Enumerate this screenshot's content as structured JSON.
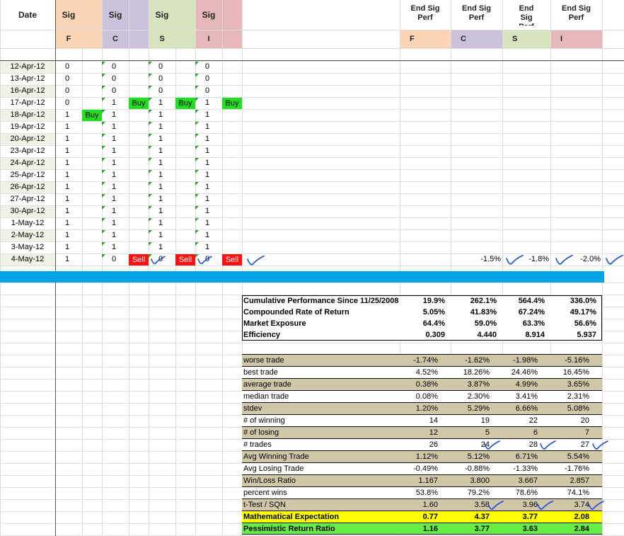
{
  "headers": {
    "date": "Date",
    "sig": [
      "Sig",
      "Sig",
      "Sig",
      "Sig"
    ],
    "sig_funds": [
      "F",
      "C",
      "S",
      "I"
    ],
    "perf": [
      "End Sig Perf",
      "End Sig Perf",
      "End Sig Perf",
      "End Sig Perf"
    ],
    "perf_funds": [
      "F",
      "C",
      "S",
      "I"
    ]
  },
  "colors": {
    "F": "#fbd5b5",
    "C": "#ccc1da",
    "S": "#d7e4bd",
    "I": "#e6b9b8",
    "buy": "#22dd22",
    "sell": "#ff1111",
    "band": "#00a2e8",
    "tan": "#d0c6a8",
    "yellow": "#ffff00",
    "green": "#66ee44",
    "check": "#1a4bd6"
  },
  "rows": [
    {
      "date": "12-Apr-12",
      "F": "0",
      "C": "0",
      "S": "0",
      "I": "0"
    },
    {
      "date": "13-Apr-12",
      "F": "0",
      "C": "0",
      "S": "0",
      "I": "0"
    },
    {
      "date": "16-Apr-12",
      "F": "0",
      "C": "0",
      "S": "0",
      "I": "0"
    },
    {
      "date": "17-Apr-12",
      "F": "0",
      "C": "1",
      "S": "1",
      "I": "1",
      "C_act": "Buy",
      "S_act": "Buy",
      "I_act": "Buy"
    },
    {
      "date": "18-Apr-12",
      "F": "1",
      "C": "1",
      "S": "1",
      "I": "1",
      "F_act": "Buy"
    },
    {
      "date": "19-Apr-12",
      "F": "1",
      "C": "1",
      "S": "1",
      "I": "1"
    },
    {
      "date": "20-Apr-12",
      "F": "1",
      "C": "1",
      "S": "1",
      "I": "1"
    },
    {
      "date": "23-Apr-12",
      "F": "1",
      "C": "1",
      "S": "1",
      "I": "1"
    },
    {
      "date": "24-Apr-12",
      "F": "1",
      "C": "1",
      "S": "1",
      "I": "1"
    },
    {
      "date": "25-Apr-12",
      "F": "1",
      "C": "1",
      "S": "1",
      "I": "1"
    },
    {
      "date": "26-Apr-12",
      "F": "1",
      "C": "1",
      "S": "1",
      "I": "1"
    },
    {
      "date": "27-Apr-12",
      "F": "1",
      "C": "1",
      "S": "1",
      "I": "1"
    },
    {
      "date": "30-Apr-12",
      "F": "1",
      "C": "1",
      "S": "1",
      "I": "1"
    },
    {
      "date": "1-May-12",
      "F": "1",
      "C": "1",
      "S": "1",
      "I": "1"
    },
    {
      "date": "2-May-12",
      "F": "1",
      "C": "1",
      "S": "1",
      "I": "1"
    },
    {
      "date": "3-May-12",
      "F": "1",
      "C": "1",
      "S": "1",
      "I": "1"
    },
    {
      "date": "4-May-12",
      "F": "1",
      "C": "0",
      "S": "0",
      "I": "0",
      "C_act": "Sell",
      "S_act": "Sell",
      "I_act": "Sell"
    }
  ],
  "end_perf": {
    "F": "",
    "C": "-1.5%",
    "S": "-1.8%",
    "I": "-2.0%"
  },
  "summary": [
    {
      "label": "Cumulative Performance Since 11/25/2008",
      "v": [
        "19.9%",
        "262.1%",
        "564.4%",
        "336.0%"
      ]
    },
    {
      "label": "Compounded Rate of Return",
      "v": [
        "5.05%",
        "41.83%",
        "67.24%",
        "49.17%"
      ]
    },
    {
      "label": "Market Exposure",
      "v": [
        "64.4%",
        "59.0%",
        "63.3%",
        "56.6%"
      ]
    },
    {
      "label": "Efficiency",
      "v": [
        "0.309",
        "4.440",
        "8.914",
        "5.937"
      ]
    }
  ],
  "stats": [
    {
      "label": "worse trade",
      "v": [
        "-1.74%",
        "-1.62%",
        "-1.98%",
        "-5.16%"
      ],
      "bg": "tan"
    },
    {
      "label": "best trade",
      "v": [
        "4.52%",
        "18.26%",
        "24.46%",
        "16.45%"
      ],
      "bg": "white"
    },
    {
      "label": "average trade",
      "v": [
        "0.38%",
        "3.87%",
        "4.99%",
        "3.65%"
      ],
      "bg": "tan"
    },
    {
      "label": "median trade",
      "v": [
        "0.08%",
        "2.30%",
        "3.41%",
        "2.31%"
      ],
      "bg": "white"
    },
    {
      "label": "stdev",
      "v": [
        "1.20%",
        "5.29%",
        "6.66%",
        "5.08%"
      ],
      "bg": "tan"
    },
    {
      "label": "# of winning",
      "v": [
        "14",
        "19",
        "22",
        "20"
      ],
      "bg": "white"
    },
    {
      "label": "# of losing",
      "v": [
        "12",
        "5",
        "6",
        "7"
      ],
      "bg": "tan"
    },
    {
      "label": "# trades",
      "v": [
        "26",
        "24",
        "28",
        "27"
      ],
      "bg": "white"
    },
    {
      "label": "Avg Winning Trade",
      "v": [
        "1.12%",
        "5.12%",
        "6.71%",
        "5.54%"
      ],
      "bg": "tan"
    },
    {
      "label": "Avg Losing Trade",
      "v": [
        "-0.49%",
        "-0.88%",
        "-1.33%",
        "-1.76%"
      ],
      "bg": "white"
    },
    {
      "label": "Win/Loss Ratio",
      "v": [
        "1.167",
        "3.800",
        "3.667",
        "2.857"
      ],
      "bg": "tan"
    },
    {
      "label": "percent wins",
      "v": [
        "53.8%",
        "79.2%",
        "78.6%",
        "74.1%"
      ],
      "bg": "white"
    },
    {
      "label": "t-Test / SQN",
      "v": [
        "1.60",
        "3.58",
        "3.96",
        "3.74"
      ],
      "bg": "tan"
    },
    {
      "label": "Mathematical Expectation",
      "v": [
        "0.77",
        "4.37",
        "3.77",
        "2.08"
      ],
      "bg": "yellow",
      "bold": true
    },
    {
      "label": "Pessimistic Return Ratio",
      "v": [
        "1.16",
        "3.77",
        "3.63",
        "2.84"
      ],
      "bg": "green",
      "bold": true
    }
  ]
}
